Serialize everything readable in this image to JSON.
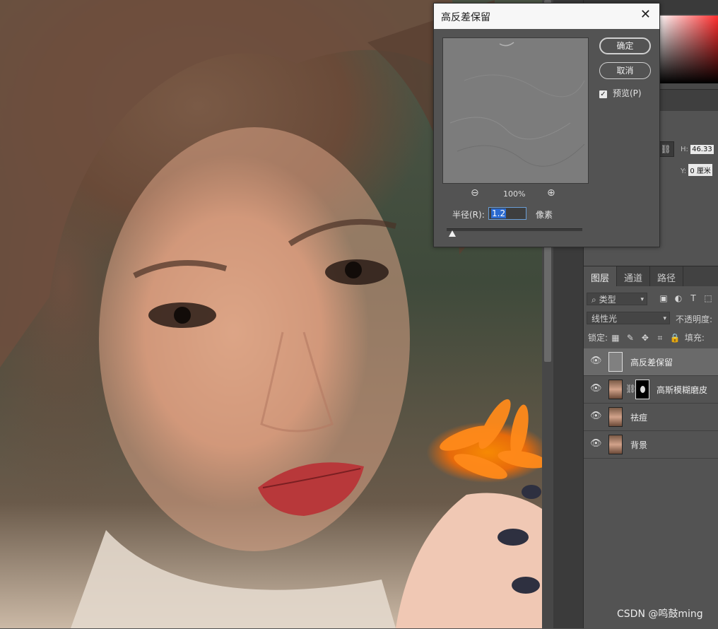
{
  "dialog": {
    "title": "高反差保留",
    "ok_label": "确定",
    "cancel_label": "取消",
    "preview_label": "预览(P)",
    "preview_checked": true,
    "zoom_out_icon": "zoom-out-icon",
    "zoom_in_icon": "zoom-in-icon",
    "zoom_level": "100%",
    "radius_label": "半径(R):",
    "radius_value": "1.2",
    "unit": "像素",
    "radius_slider_fraction": 0.04
  },
  "properties": {
    "h_label": "H:",
    "h_value": "46.33",
    "y_label": "Y:",
    "y_value": "0 厘米"
  },
  "layers_panel": {
    "tabs": [
      "图层",
      "通道",
      "路径"
    ],
    "active_tab": "图层",
    "filter_kind": "类型",
    "blend_mode": "线性光",
    "opacity_label": "不透明度:",
    "lock_label": "锁定:",
    "fill_label": "填充:",
    "layers": [
      {
        "name": "高反差保留",
        "selected": true,
        "thumb": "gray"
      },
      {
        "name": "高斯模糊磨皮",
        "selected": false,
        "thumb": "photo",
        "mask": true
      },
      {
        "name": "祛痘",
        "selected": false,
        "thumb": "photo"
      },
      {
        "name": "背景",
        "selected": false,
        "thumb": "photo"
      }
    ]
  },
  "watermark": "CSDN @鸣鼓ming",
  "colors": {
    "panel_bg": "#535353",
    "selected_layer": "#6a6a6a",
    "input_highlight": "#2a6ad0"
  }
}
